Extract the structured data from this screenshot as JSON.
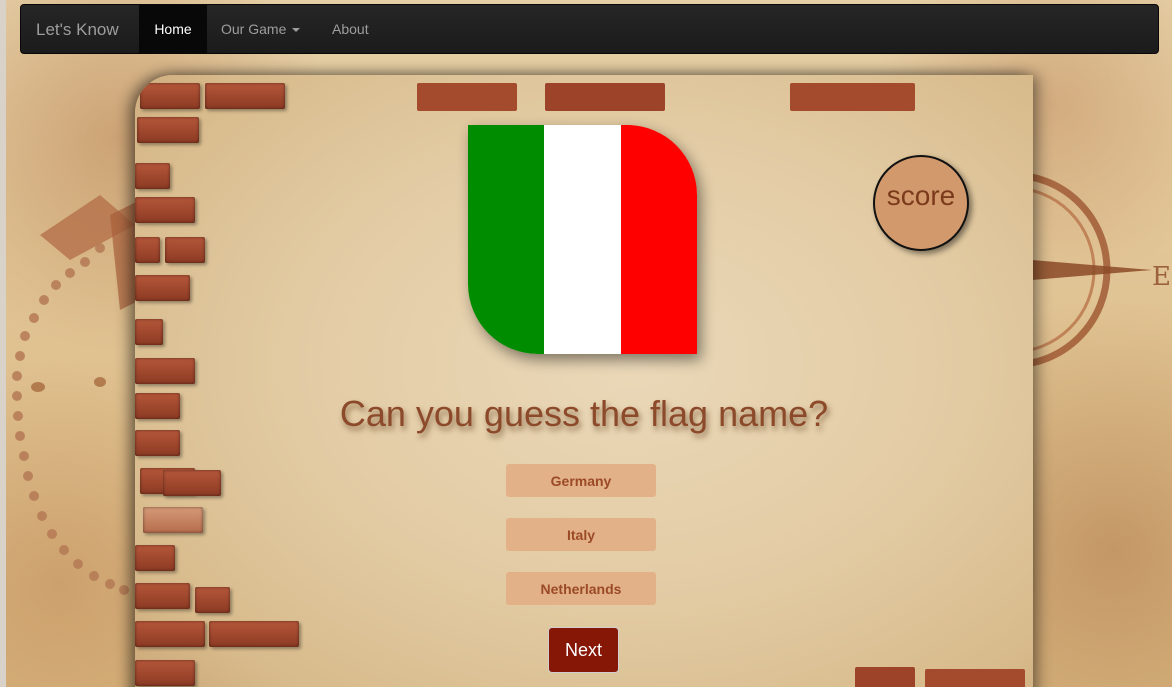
{
  "navbar": {
    "brand": "Let's Know",
    "home": "Home",
    "game": "Our Game",
    "about": "About"
  },
  "flag": {
    "country": "Italy",
    "colors": [
      "#008c00",
      "#ffffff",
      "#ff0000"
    ]
  },
  "score": {
    "label": "score"
  },
  "question": "Can you guess the flag name?",
  "answers": [
    "Germany",
    "Italy",
    "Netherlands"
  ],
  "next_label": "Next",
  "colors": {
    "navbar_bg": "#1b1b1b",
    "answer_bg": "#e3b187",
    "answer_text": "#9b4a27",
    "next_bg": "#861606",
    "score_bg": "#d29a6c",
    "question_text": "#8c4a2b"
  }
}
